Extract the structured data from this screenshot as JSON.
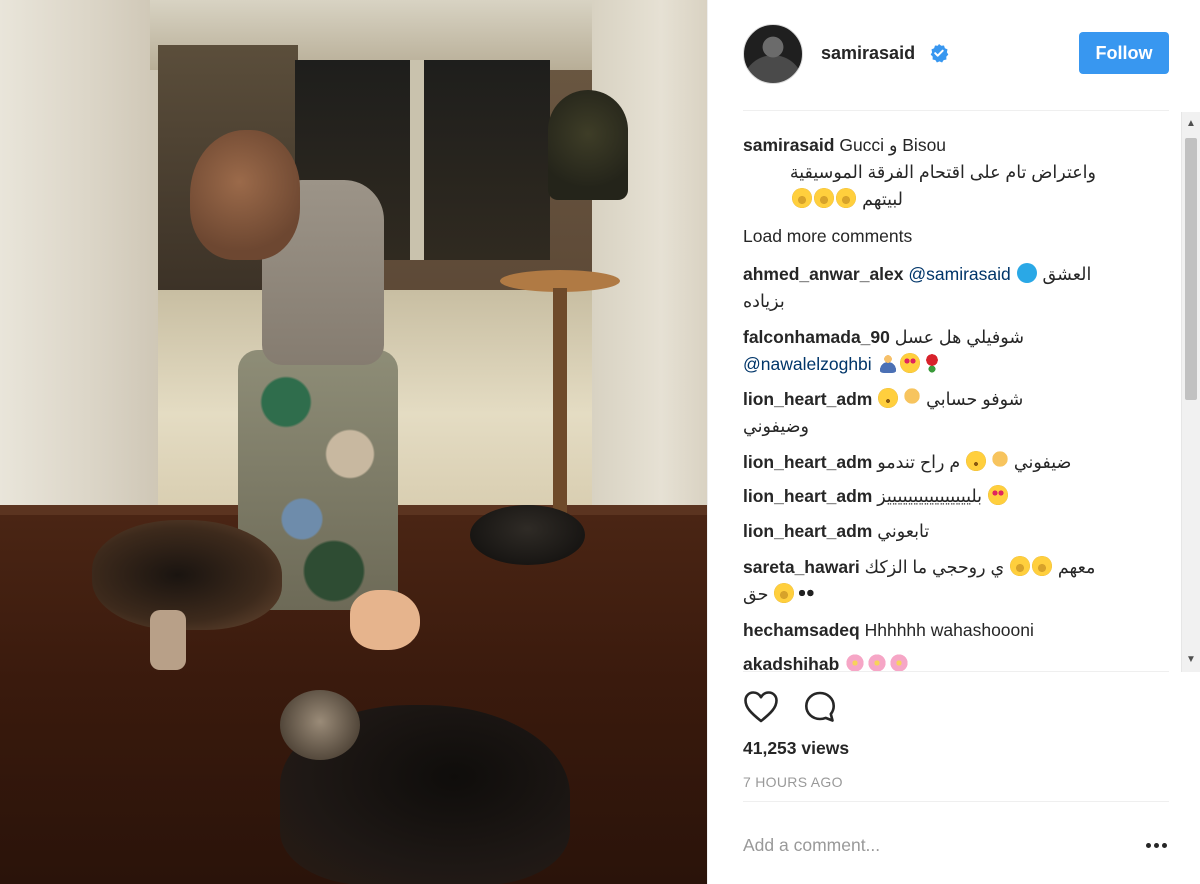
{
  "post": {
    "username": "samirasaid",
    "follow_label": "Follow",
    "caption_user": "samirasaid",
    "caption_line1": "Gucci و Bisou",
    "caption_line2": "واعتراض تام على اقتحام الفرقة الموسيقية",
    "caption_line3": "لبيتهم",
    "load_more_label": "Load more comments",
    "views": "41,253 views",
    "time": "7 HOURS AGO",
    "add_comment_placeholder": "Add a comment..."
  },
  "comments": [
    {
      "user": "ahmed_anwar_alex",
      "mention": "@samirasaid",
      "text": "العشق",
      "line2": "بزياده"
    },
    {
      "user": "falconhamada_90",
      "text": "شوفيلي هل عسل",
      "mention": "@nawalelzoghbi"
    },
    {
      "user": "lion_heart_adm",
      "text": "شوفو حسابي",
      "line2": "وضيفوني"
    },
    {
      "user": "lion_heart_adm",
      "text": "م راح تندمو",
      "text_b": "ضيفوني"
    },
    {
      "user": "lion_heart_adm",
      "text": "بلييييييييييييييييز"
    },
    {
      "user": "lion_heart_adm",
      "text": "تابعوني"
    },
    {
      "user": "sareta_hawari",
      "text": "ي روحجي ما الزكك",
      "text_b": "معهم",
      "line2": "حق"
    },
    {
      "user": "hechamsadeq",
      "text": "Hhhhhh wahashoooni"
    },
    {
      "user": "akadshihab"
    }
  ],
  "icons": {
    "verified": "verified-badge-icon",
    "like": "heart-icon",
    "comment": "comment-bubble-icon",
    "more": "more-options-icon"
  },
  "colors": {
    "accent": "#3897f0",
    "muted": "#999999",
    "mention": "#003569"
  }
}
